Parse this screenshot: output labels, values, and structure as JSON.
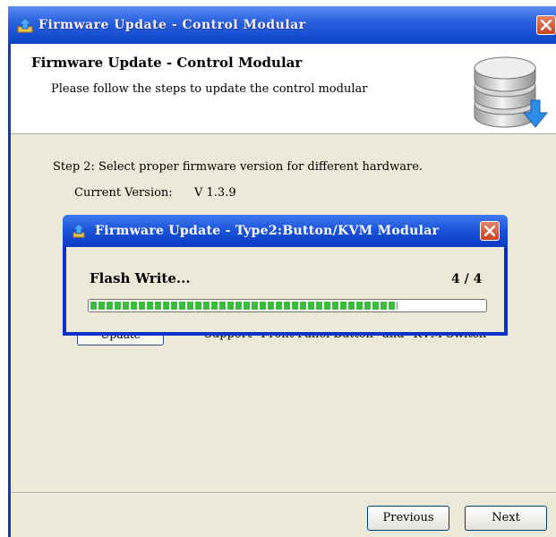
{
  "window": {
    "title": "Firmware Update - Control Modular",
    "icon": "firmware-arrow-icon"
  },
  "header": {
    "title": "Firmware Update - Control Modular",
    "subtitle": "Please follow the steps to update the control modular",
    "icon": "database-download-icon"
  },
  "step": {
    "text": "Step 2: Select proper firmware version for different hardware.",
    "version_label": "Current Version:",
    "version_value": "V 1.3.9"
  },
  "row": {
    "update_label": "Update",
    "support_text": "Support \"Front Panel Button\" and \"KVM Switch\""
  },
  "footer": {
    "previous_label": "Previous",
    "next_label": "Next"
  },
  "dialog": {
    "title": "Firmware Update  - Type2:Button/KVM Modular",
    "status": "Flash Write...",
    "count": "4 / 4",
    "progress_fraction": 0.78
  },
  "colors": {
    "titlebar": "#0c44c8",
    "body": "#ece9d8",
    "progress": "#3cbc3c",
    "close": "#c9431f"
  }
}
